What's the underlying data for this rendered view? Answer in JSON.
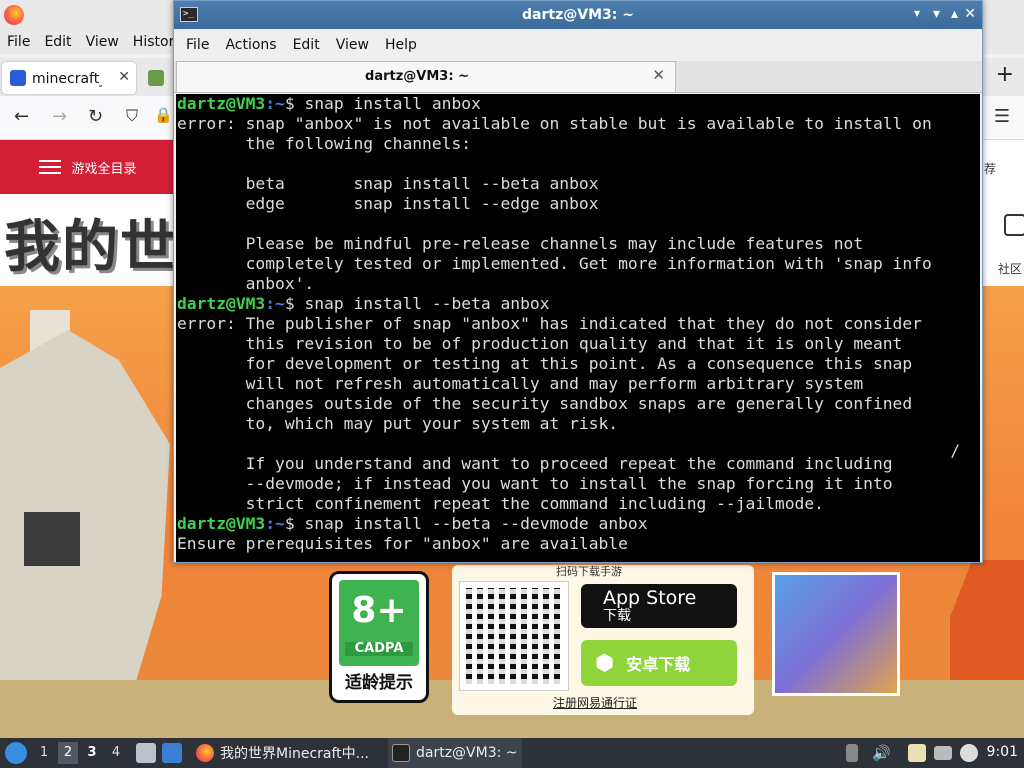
{
  "firefox": {
    "menu": [
      "File",
      "Edit",
      "View",
      "History"
    ],
    "tab1_label": "minecraft_百",
    "tab_close": "✕",
    "new_tab": "+",
    "site": {
      "nav_all_games": "游戏全目录",
      "nav_right": "荐",
      "logo_text": "我的世",
      "chat_label": "社区",
      "cadpa_age": "8+",
      "cadpa_org": "CADPA",
      "cadpa_label": "适龄提示",
      "scan_text": "扫码下载手游",
      "appstore_line1": "App Store",
      "appstore_line2": "下载",
      "android_label": "安卓下载",
      "register_text": "注册网易通行证"
    }
  },
  "terminal": {
    "title": "dartz@VM3: ~",
    "menu": [
      "File",
      "Actions",
      "Edit",
      "View",
      "Help"
    ],
    "tab_label": "dartz@VM3: ~",
    "prompt_user": "dartz@VM3",
    "prompt_path": ":~",
    "lines": [
      {
        "type": "cmd",
        "text": "$ snap install anbox"
      },
      {
        "type": "out",
        "text": "error: snap \"anbox\" is not available on stable but is available to install on"
      },
      {
        "type": "out",
        "text": "       the following channels:"
      },
      {
        "type": "out",
        "text": ""
      },
      {
        "type": "out",
        "text": "       beta       snap install --beta anbox"
      },
      {
        "type": "out",
        "text": "       edge       snap install --edge anbox"
      },
      {
        "type": "out",
        "text": ""
      },
      {
        "type": "out",
        "text": "       Please be mindful pre-release channels may include features not"
      },
      {
        "type": "out",
        "text": "       completely tested or implemented. Get more information with 'snap info"
      },
      {
        "type": "out",
        "text": "       anbox'."
      },
      {
        "type": "cmd",
        "text": "$ snap install --beta anbox"
      },
      {
        "type": "out",
        "text": "error: The publisher of snap \"anbox\" has indicated that they do not consider"
      },
      {
        "type": "out",
        "text": "       this revision to be of production quality and that it is only meant"
      },
      {
        "type": "out",
        "text": "       for development or testing at this point. As a consequence this snap"
      },
      {
        "type": "out",
        "text": "       will not refresh automatically and may perform arbitrary system"
      },
      {
        "type": "out",
        "text": "       changes outside of the security sandbox snaps are generally confined"
      },
      {
        "type": "out",
        "text": "       to, which may put your system at risk."
      },
      {
        "type": "out",
        "text": ""
      },
      {
        "type": "out",
        "text": "       If you understand and want to proceed repeat the command including"
      },
      {
        "type": "out",
        "text": "       --devmode; if instead you want to install the snap forcing it into"
      },
      {
        "type": "out",
        "text": "       strict confinement repeat the command including --jailmode."
      },
      {
        "type": "cmd",
        "text": "$ snap install --beta --devmode anbox"
      },
      {
        "type": "out",
        "text": "Ensure prerequisites for \"anbox\" are available"
      }
    ],
    "spinner": "/"
  },
  "taskbar": {
    "workspaces": [
      "1",
      "2",
      "3",
      "4"
    ],
    "apps": [
      {
        "label": "我的世界Minecraft中..."
      },
      {
        "label": "dartz@VM3: ~"
      }
    ],
    "time": "9:01"
  }
}
